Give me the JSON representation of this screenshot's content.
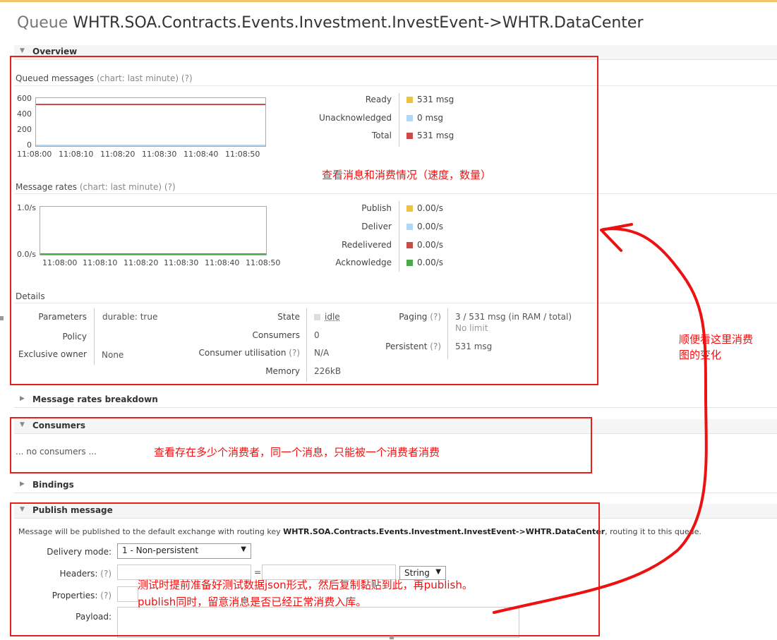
{
  "title": {
    "prefix": "Queue",
    "name": "WHTR.SOA.Contracts.Events.Investment.InvestEvent->WHTR.DataCenter"
  },
  "overview": {
    "label": "Overview",
    "queued_messages": {
      "heading": "Queued messages",
      "hint": "(chart: last minute) (?)",
      "y_ticks": [
        "600",
        "400",
        "200",
        "0"
      ],
      "x_ticks": [
        "11:08:00",
        "11:08:10",
        "11:08:20",
        "11:08:30",
        "11:08:40",
        "11:08:50"
      ],
      "legend": [
        {
          "label": "Ready",
          "value": "531 msg",
          "color": "#edc240"
        },
        {
          "label": "Unacknowledged",
          "value": "0 msg",
          "color": "#afd8f8"
        },
        {
          "label": "Total",
          "value": "531 msg",
          "color": "#cb4b4b"
        }
      ]
    },
    "message_rates": {
      "heading": "Message rates",
      "hint": "(chart: last minute) (?)",
      "y_ticks": [
        "1.0/s",
        "0.0/s"
      ],
      "x_ticks": [
        "11:08:00",
        "11:08:10",
        "11:08:20",
        "11:08:30",
        "11:08:40",
        "11:08:50"
      ],
      "legend": [
        {
          "label": "Publish",
          "value": "0.00/s",
          "color": "#edc240"
        },
        {
          "label": "Deliver",
          "value": "0.00/s",
          "color": "#afd8f8"
        },
        {
          "label": "Redelivered",
          "value": "0.00/s",
          "color": "#cb4b4b"
        },
        {
          "label": "Acknowledge",
          "value": "0.00/s",
          "color": "#4da74d"
        }
      ]
    },
    "details": {
      "heading": "Details",
      "parameters_label": "Parameters",
      "parameters_value": "durable: true",
      "policy_label": "Policy",
      "exclusive_label": "Exclusive owner",
      "exclusive_value": "None",
      "state_label": "State",
      "state_value": "idle",
      "consumers_label": "Consumers",
      "consumers_value": "0",
      "utilisation_label": "Consumer utilisation",
      "utilisation_hint": "(?)",
      "utilisation_value": "N/A",
      "memory_label": "Memory",
      "memory_value": "226kB",
      "paging_label": "Paging",
      "paging_hint": "(?)",
      "paging_value": "3 / 531 msg (in RAM / total)",
      "paging_limit": "No limit",
      "persistent_label": "Persistent",
      "persistent_hint": "(?)",
      "persistent_value": "531 msg"
    }
  },
  "rates_breakdown": {
    "label": "Message rates breakdown"
  },
  "consumers": {
    "label": "Consumers",
    "empty": "... no consumers ..."
  },
  "bindings": {
    "label": "Bindings"
  },
  "publish": {
    "label": "Publish message",
    "note_prefix": "Message will be published to the default exchange with routing key ",
    "note_key": "WHTR.SOA.Contracts.Events.Investment.InvestEvent->WHTR.DataCenter",
    "note_suffix": ", routing it to this queue.",
    "delivery_label": "Delivery mode:",
    "delivery_value": "1 - Non-persistent",
    "headers_label": "Headers:",
    "headers_hint": "(?)",
    "equals": "=",
    "type_value": "String",
    "properties_label": "Properties:",
    "properties_hint": "(?)",
    "payload_label": "Payload:"
  },
  "annotations": {
    "overview_note": "查看消息和消费情况（速度，数量）",
    "side_note_1": "顺便看这里消费",
    "side_note_2": "图的变化",
    "consumers_note": "查看存在多少个消费者，同一个消息，只能被一个消费者消费",
    "publish_note_1": "测试时提前准备好测试数据json形式，然后复制黏贴到此，再publish。",
    "publish_note_2": "publish同时，留意消息是否已经正常消费入库。"
  },
  "colors": {
    "accent_line": "#f0c36d",
    "annotation": "#e62020"
  }
}
